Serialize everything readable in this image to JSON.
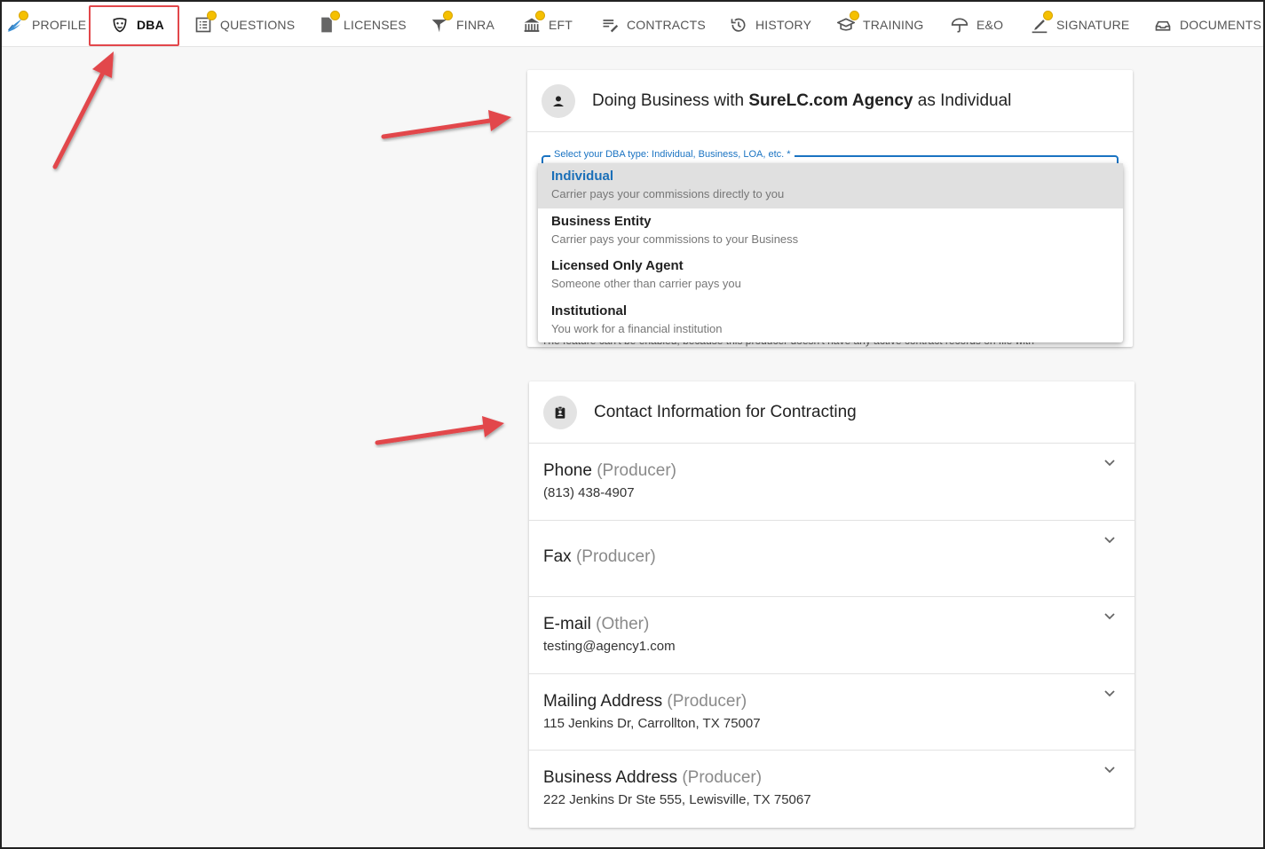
{
  "nav": {
    "items": [
      {
        "label": "PROFILE",
        "icon": "bird-logo-icon",
        "dot": true
      },
      {
        "label": "DBA",
        "icon": "mask-icon",
        "dot": false,
        "active": true
      },
      {
        "label": "QUESTIONS",
        "icon": "list-icon",
        "dot": true
      },
      {
        "label": "LICENSES",
        "icon": "document-icon",
        "dot": true
      },
      {
        "label": "FINRA",
        "icon": "finra-icon",
        "dot": true
      },
      {
        "label": "EFT",
        "icon": "bank-icon",
        "dot": true
      },
      {
        "label": "CONTRACTS",
        "icon": "edit-list-icon",
        "dot": false
      },
      {
        "label": "HISTORY",
        "icon": "history-icon",
        "dot": false
      },
      {
        "label": "TRAINING",
        "icon": "graduation-cap-icon",
        "dot": true
      },
      {
        "label": "E&O",
        "icon": "umbrella-icon",
        "dot": false
      },
      {
        "label": "SIGNATURE",
        "icon": "pen-icon",
        "dot": true
      },
      {
        "label": "DOCUMENTS",
        "icon": "tray-icon",
        "dot": false
      }
    ]
  },
  "dba": {
    "title_prefix": "Doing Business with ",
    "agency": "SureLC.com Agency",
    "title_suffix": " as Individual",
    "select_label": "Select your DBA type: Individual, Business, LOA, etc. *",
    "hidden_note": "The feature can't be enabled, because this producer doesn't have any active contract records on file with",
    "options": [
      {
        "title": "Individual",
        "sub": "Carrier pays your commissions directly to you"
      },
      {
        "title": "Business Entity",
        "sub": "Carrier pays your commissions to your Business"
      },
      {
        "title": "Licensed Only Agent",
        "sub": "Someone other than carrier pays you"
      },
      {
        "title": "Institutional",
        "sub": "You work for a financial institution"
      }
    ]
  },
  "contact": {
    "title": "Contact Information for Contracting",
    "rows": [
      {
        "label": "Phone",
        "tag": "(Producer)",
        "value": "(813) 438-4907"
      },
      {
        "label": "Fax",
        "tag": "(Producer)",
        "value": ""
      },
      {
        "label": "E-mail",
        "tag": "(Other)",
        "value": "testing@agency1.com"
      },
      {
        "label": "Mailing Address",
        "tag": "(Producer)",
        "value": "115 Jenkins Dr, Carrollton, TX 75007"
      },
      {
        "label": "Business Address",
        "tag": "(Producer)",
        "value": "222 Jenkins Dr Ste 555, Lewisville, TX 75067"
      }
    ]
  },
  "colors": {
    "accent": "#1a73c2",
    "annotation": "#e2474b",
    "badge": "#f5c000"
  }
}
